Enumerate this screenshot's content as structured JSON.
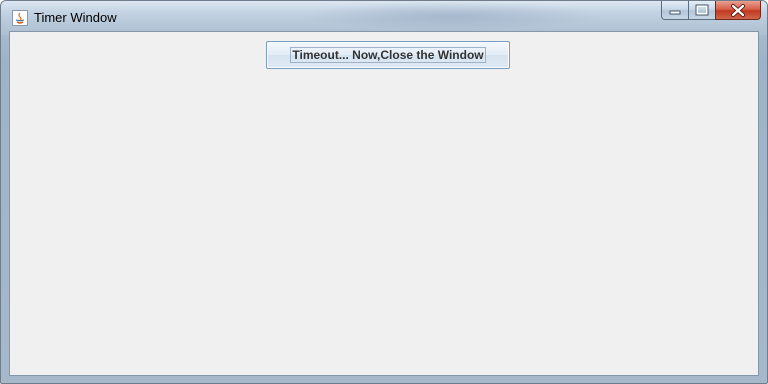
{
  "window": {
    "title": "Timer Window",
    "app_icon": "java-icon",
    "controls": {
      "minimize_icon": "minimize-icon",
      "maximize_icon": "maximize-icon",
      "close_icon": "close-icon"
    }
  },
  "content": {
    "button_label": "Timeout... Now,Close the Window"
  },
  "colors": {
    "client_background": "#f0f0f0",
    "close_button": "#c0391f",
    "titlebar": "#b9cadb"
  }
}
